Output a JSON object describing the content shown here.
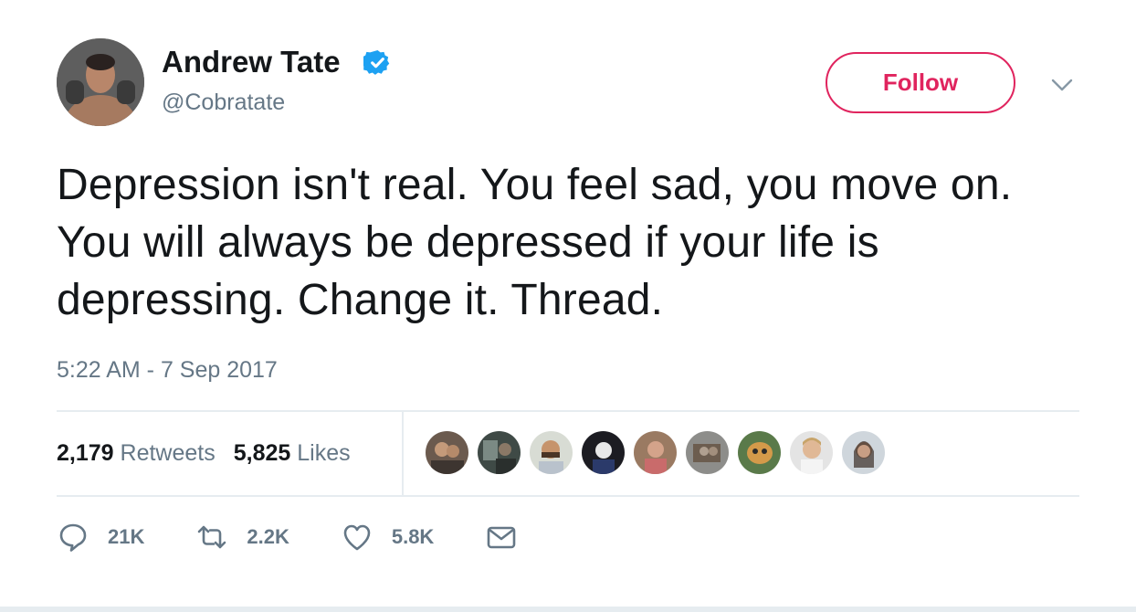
{
  "author": {
    "display_name": "Andrew Tate",
    "handle": "@Cobratate",
    "verified": true
  },
  "header": {
    "follow_label": "Follow",
    "accent_color": "#e0245e",
    "verified_color": "#1da1f2"
  },
  "tweet": {
    "text": "Depression isn't real. You feel sad, you move on. You will always be depressed if your life is depressing. Change it. Thread.",
    "timestamp": "5:22 AM - 7 Sep 2017"
  },
  "stats": {
    "retweets_count": "2,179",
    "retweets_label": "Retweets",
    "likes_count": "5,825",
    "likes_label": "Likes"
  },
  "likers": [
    {
      "name": "liker-avatar-1"
    },
    {
      "name": "liker-avatar-2"
    },
    {
      "name": "liker-avatar-3"
    },
    {
      "name": "liker-avatar-4"
    },
    {
      "name": "liker-avatar-5"
    },
    {
      "name": "liker-avatar-6"
    },
    {
      "name": "liker-avatar-7"
    },
    {
      "name": "liker-avatar-8"
    },
    {
      "name": "liker-avatar-9"
    }
  ],
  "actions": {
    "reply_count": "21K",
    "retweet_count": "2.2K",
    "like_count": "5.8K",
    "icons": [
      "reply-icon",
      "retweet-icon",
      "heart-icon",
      "message-icon"
    ]
  }
}
